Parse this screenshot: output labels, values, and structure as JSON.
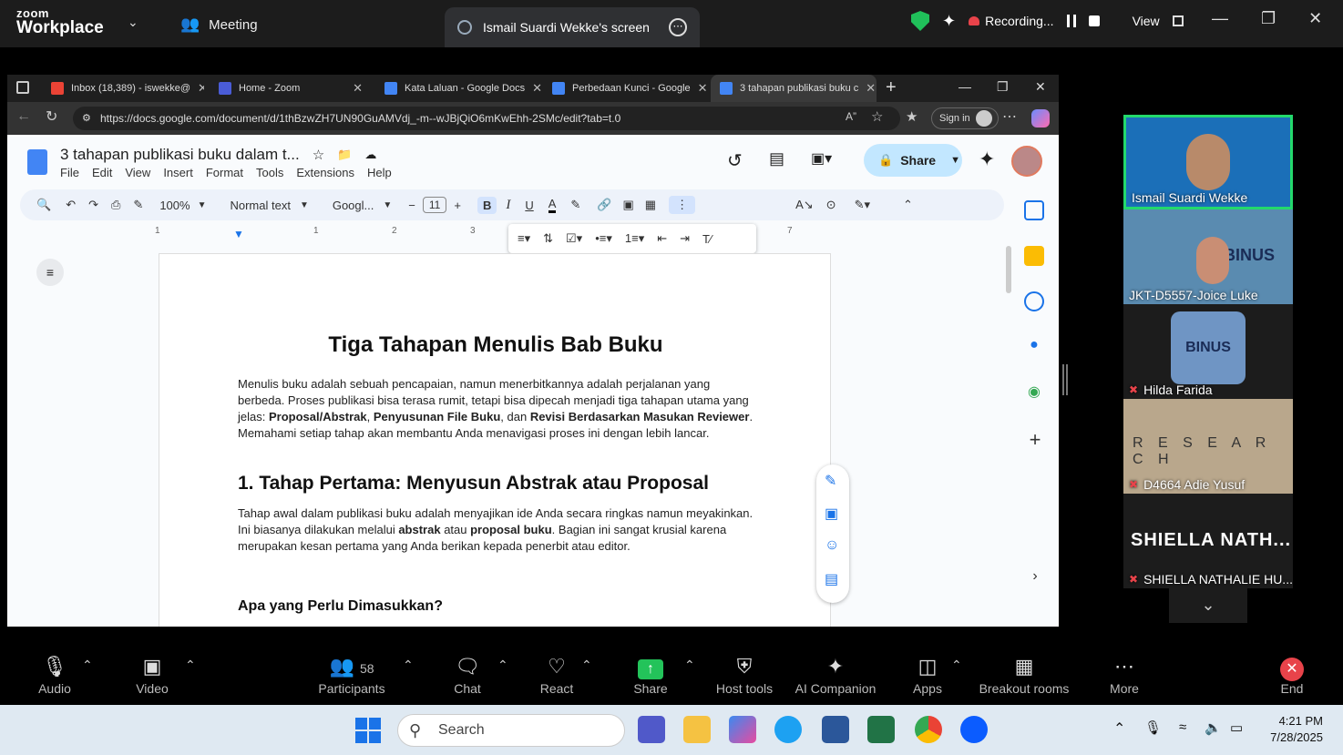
{
  "zoom": {
    "brand_small": "zoom",
    "brand_big": "Workplace",
    "meeting_label": "Meeting",
    "share_tab_label": "Ismail Suardi Wekke's screen",
    "recording_label": "Recording...",
    "view_label": "View"
  },
  "browser": {
    "tabs": [
      {
        "label": "Inbox (18,389) - iswekke@",
        "color": "#ea4335"
      },
      {
        "label": "Home - Zoom",
        "color": "#4a5cd6"
      },
      {
        "label": "Kata Laluan - Google Docs",
        "color": "#4285f4"
      },
      {
        "label": "Perbedaan Kunci - Google",
        "color": "#4285f4"
      },
      {
        "label": "3 tahapan publikasi buku c",
        "color": "#4285f4"
      }
    ],
    "url": "https://docs.google.com/document/d/1thBzwZH7UN90GuAMVdj_-m--wJBjQiO6mKwEhh-2SMc/edit?tab=t.0",
    "signin_label": "Sign in"
  },
  "doc": {
    "title": "3 tahapan publikasi buku dalam t...",
    "menus": [
      "File",
      "Edit",
      "View",
      "Insert",
      "Format",
      "Tools",
      "Extensions",
      "Help"
    ],
    "share_label": "Share",
    "toolbar": {
      "zoom": "100%",
      "style": "Normal text",
      "font": "Googl...",
      "size": "11"
    },
    "ruler_marks": [
      "1",
      "1",
      "2",
      "3",
      "7"
    ],
    "heading": "Tiga Tahapan Menulis Bab Buku",
    "intro_a": "Menulis buku adalah sebuah pencapaian, namun menerbitkannya adalah perjalanan yang berbeda. Proses publikasi bisa terasa rumit, tetapi bisa dipecah menjadi tiga tahapan utama yang jelas: ",
    "intro_b1": "Proposal/Abstrak",
    "intro_c": ", ",
    "intro_b2": "Penyusunan File Buku",
    "intro_d": ", dan ",
    "intro_b3": "Revisi Berdasarkan Masukan Reviewer",
    "intro_e": ". Memahami setiap tahap akan membantu Anda menavigasi proses ini dengan lebih lancar.",
    "section1": "1. Tahap Pertama: Menyusun Abstrak atau Proposal",
    "s1_a": "Tahap awal dalam publikasi buku adalah menyajikan ide Anda secara ringkas namun meyakinkan. Ini biasanya dilakukan melalui ",
    "s1_b1": "abstrak",
    "s1_c": " atau ",
    "s1_b2": "proposal buku",
    "s1_d": ". Bagian ini sangat krusial karena merupakan kesan pertama yang Anda berikan kepada penerbit atau editor.",
    "subheading": "Apa yang Perlu Dimasukkan?"
  },
  "participants": [
    {
      "name": "Ismail Suardi Wekke",
      "bg": "#1b6fb8",
      "muted": false
    },
    {
      "name": "JKT-D5557-Joice Luke",
      "bg": "#5a8bb0",
      "muted": false
    },
    {
      "name": "Hilda Farida",
      "bg": "#1c1c1c",
      "muted": true
    },
    {
      "name": "D4664 Adie Yusuf",
      "bg": "#b9a78c",
      "muted": true
    },
    {
      "name": "SHIELLA NATHALIE HU...",
      "big": "SHIELLA NATH...",
      "bg": "#1c1c1c",
      "muted": true
    }
  ],
  "controls": {
    "audio": "Audio",
    "video": "Video",
    "participants": "Participants",
    "participants_count": "58",
    "chat": "Chat",
    "react": "React",
    "share": "Share",
    "host_tools": "Host tools",
    "ai_companion": "AI Companion",
    "apps": "Apps",
    "breakout": "Breakout rooms",
    "more": "More",
    "end": "End"
  },
  "taskbar": {
    "search_placeholder": "Search",
    "time": "4:21 PM",
    "date": "7/28/2025"
  }
}
